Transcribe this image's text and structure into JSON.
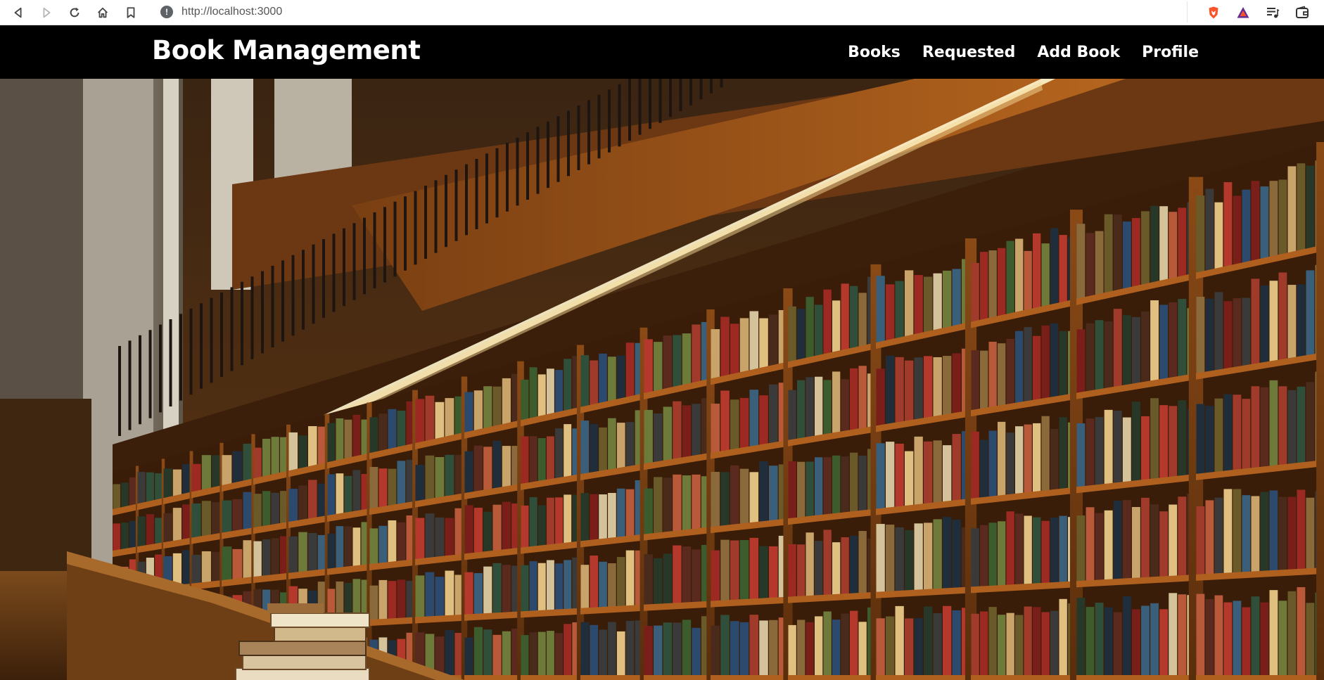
{
  "browser": {
    "url": "http://localhost:3000",
    "icons": [
      "back-icon",
      "forward-icon",
      "reload-icon",
      "home-icon",
      "bookmark-icon",
      "site-info-icon",
      "brave-shield-icon",
      "brave-rewards-icon",
      "playlist-icon",
      "wallet-icon"
    ]
  },
  "navbar": {
    "brand": "Book Management",
    "links": [
      "Books",
      "Requested",
      "Add Book",
      "Profile"
    ]
  },
  "hero": {
    "image": "library-bookshelves-photo"
  },
  "colors": {
    "navbar_bg": "#000000",
    "navbar_text": "#ffffff",
    "brave_orange": "#fb542b",
    "brave_purple": "#662d91"
  }
}
